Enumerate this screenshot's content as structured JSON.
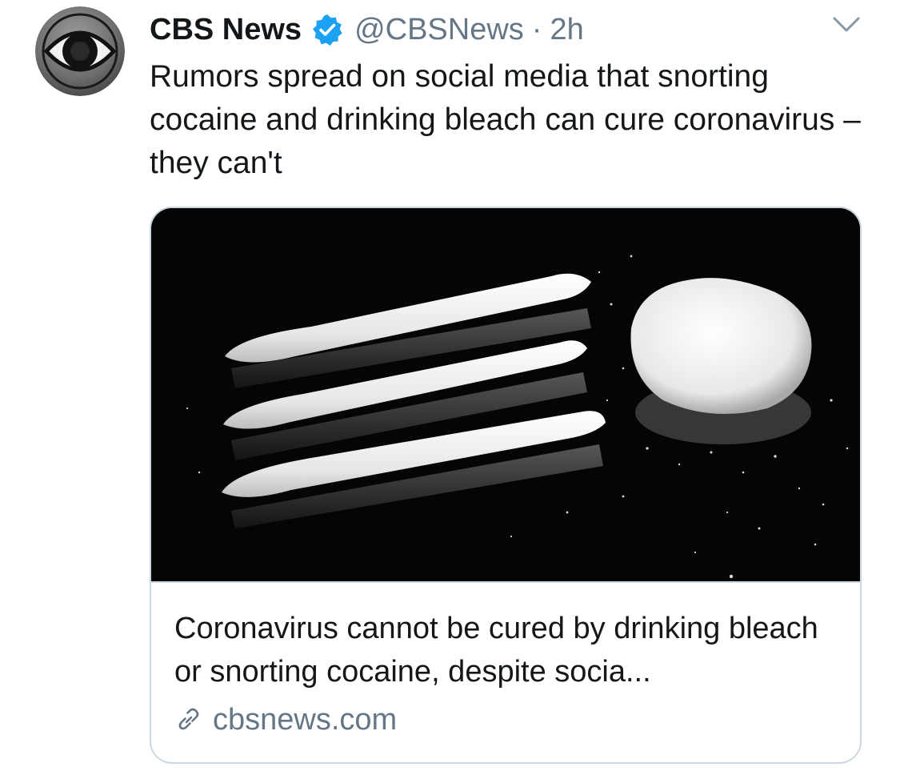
{
  "tweet": {
    "author": {
      "display_name": "CBS News",
      "verified": true,
      "handle": "@CBSNews",
      "avatar_icon": "cbs-eye-logo"
    },
    "separator": "·",
    "time_ago": "2h",
    "text": "Rumors spread on social media that snorting cocaine and drinking bleach can cure coronavirus – they can't",
    "menu_icon": "chevron-down-icon"
  },
  "card": {
    "image_subject": "lines of white powder beside a pile of powder on a black surface",
    "title": "Coronavirus cannot be cured by drinking bleach or snorting cocaine, despite socia...",
    "domain": "cbsnews.com",
    "domain_icon": "link-icon"
  },
  "colors": {
    "text_primary": "#14171a",
    "text_secondary": "#657786",
    "verified_blue": "#1da1f2",
    "border": "#ccd6dd"
  }
}
